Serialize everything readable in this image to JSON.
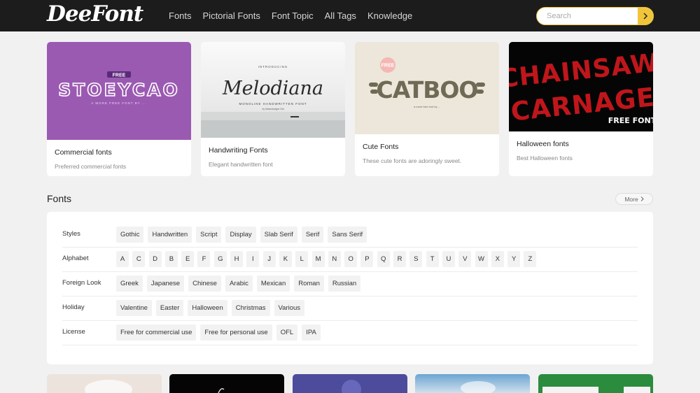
{
  "header": {
    "logo": "DeeFont",
    "nav": [
      "Fonts",
      "Pictorial Fonts",
      "Font Topic",
      "All Tags",
      "Knowledge"
    ],
    "search_placeholder": "Search"
  },
  "cards": [
    {
      "title": "Commercial fonts",
      "desc": "Preferred commercial fonts",
      "art_badge": "FREE",
      "art_text": "STOEYCAO",
      "art_sub": "A MORE FREE FONT BY ..."
    },
    {
      "title": "Handwriting Fonts",
      "desc": "Elegant handwritten font",
      "art_top": "INTRODUCING",
      "art_text": "Melodiana",
      "art_sub": "MONOLINE HANDWRITTEN FONT",
      "art_sub2": "by Missinkatype Std"
    },
    {
      "title": "Cute Fonts",
      "desc": "These cute fonts are adoringly sweet.",
      "art_badge": "FREE",
      "art_text": "CATBOO",
      "art_sub": "a more free font by ..."
    },
    {
      "title": "Halloween fonts",
      "desc": "Best Halloween fonts",
      "art_text1": "CHAINSAW",
      "art_text2": "CARNAGE",
      "art_sub": "FREE FONT"
    }
  ],
  "fonts_section": {
    "title": "Fonts",
    "more": "More",
    "rows": [
      {
        "label": "Styles",
        "tags": [
          "Gothic",
          "Handwritten",
          "Script",
          "Display",
          "Slab Serif",
          "Serif",
          "Sans Serif"
        ]
      },
      {
        "label": "Alphabet",
        "tags": [
          "A",
          "C",
          "D",
          "B",
          "E",
          "F",
          "G",
          "H",
          "I",
          "J",
          "K",
          "L",
          "M",
          "N",
          "O",
          "P",
          "Q",
          "R",
          "S",
          "T",
          "U",
          "V",
          "W",
          "X",
          "Y",
          "Z"
        ]
      },
      {
        "label": "Foreign Look",
        "tags": [
          "Greek",
          "Japanese",
          "Chinese",
          "Arabic",
          "Mexican",
          "Roman",
          "Russian"
        ]
      },
      {
        "label": "Holiday",
        "tags": [
          "Valentine",
          "Easter",
          "Halloween",
          "Christmas",
          "Various"
        ]
      },
      {
        "label": "License",
        "tags": [
          "Free for commercial use",
          "Free for personal use",
          "OFL",
          "IPA"
        ]
      }
    ]
  },
  "colors": {
    "header_bg": "#1c1c1c",
    "accent": "#f0c53a",
    "page_bg": "#f1f1f1"
  }
}
